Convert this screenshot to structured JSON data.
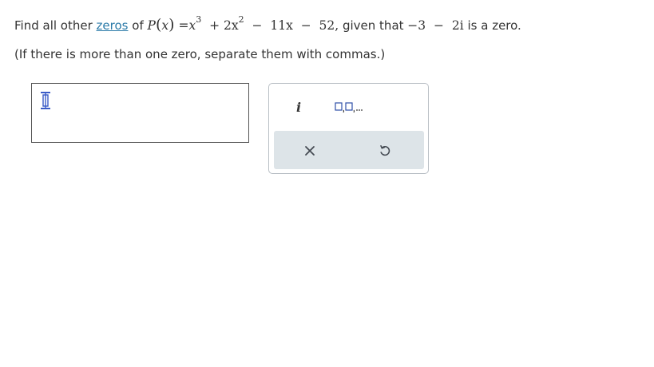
{
  "question": {
    "prefix": "Find all other",
    "link_text": "zeros",
    "of_text": "of",
    "func_name": "P",
    "var": "x",
    "equals": "=",
    "x1": "x",
    "exp1": "3",
    "plus": "+",
    "term2": "2x",
    "exp2": "2",
    "minus1": "−",
    "term3": "11x",
    "minus2": "−",
    "term4": "52,",
    "given": "given that",
    "zero_real": "−3",
    "minus3": "−",
    "zero_imag": "2i",
    "suffix": "is a zero."
  },
  "instruction": "(If there is more than one zero, separate them with commas.)",
  "answer": {
    "value": ""
  },
  "toolbar": {
    "imaginary_label": "i",
    "list_icon": "list-template-icon",
    "clear_icon": "close-icon",
    "reset_icon": "undo-icon"
  },
  "colors": {
    "link": "#2a7aa8",
    "text": "#333333",
    "toolbar_bottom_bg": "#dde4e8",
    "cursor_icon": "#3a5bc7"
  }
}
